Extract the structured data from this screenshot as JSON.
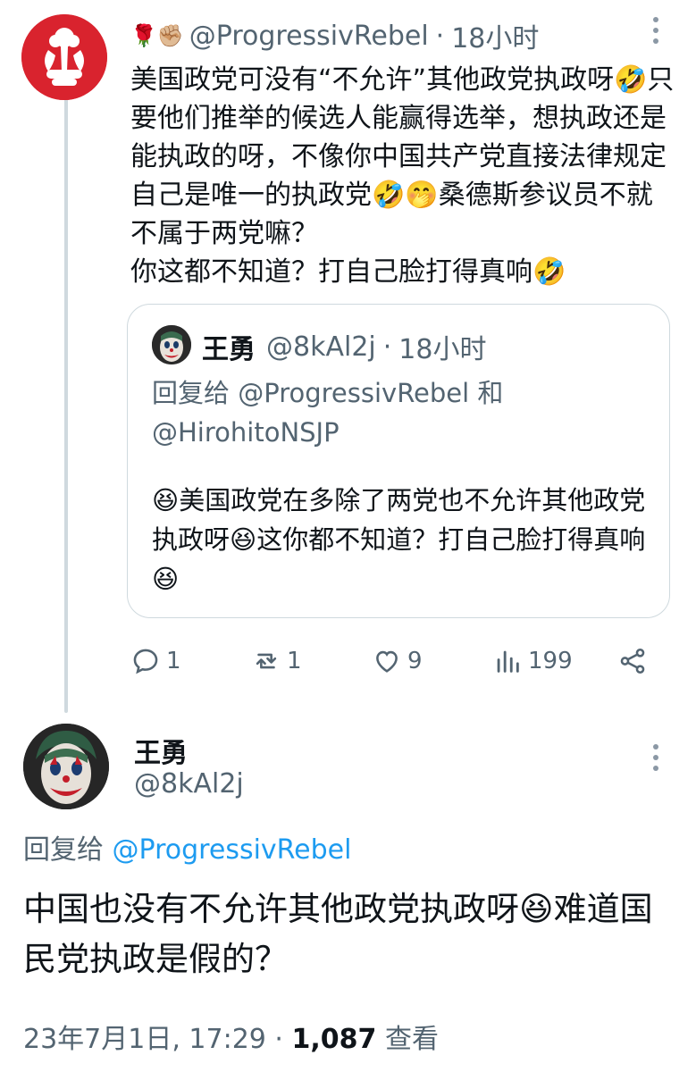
{
  "original_tweet": {
    "flair": "🌹✊🏼",
    "handle": "@ProgressivRebel",
    "separator": "·",
    "time": "18小时",
    "text": "美国政党可没有“不允许”其他政党执政呀🤣只要他们推举的候选人能赢得选举，想执政还是能执政的呀，不像你中国共产党直接法律规定自己是唯一的执政党🤣🤭桑德斯参议员不就不属于两党嘛？\n你这都不知道？打自己脸打得真响🤣",
    "quote": {
      "name": "王勇",
      "handle": "@8kAl2j",
      "separator": "·",
      "time": "18小时",
      "reply_prefix": "回复给 @ProgressivRebel 和 @HirohitoNSJP",
      "text": "😆美国政党在多除了两党也不允许其他政党执政呀😆这你都不知道？打自己脸打得真响😆"
    },
    "actions": {
      "reply_count": "1",
      "retweet_count": "1",
      "like_count": "9",
      "view_count": "199"
    }
  },
  "reply_tweet": {
    "name": "王勇",
    "handle": "@8kAl2j",
    "reply_label": "回复给",
    "reply_mention": "@ProgressivRebel",
    "text": "中国也没有不允许其他政党执政呀😆难道国民党执政是假的？",
    "timestamp": "23年7月1日, 17:29",
    "separator": "·",
    "views_count": "1,087",
    "views_label": "查看"
  },
  "colors": {
    "link": "#1d9bf0",
    "secondary": "#536471",
    "border": "#cfd9de",
    "avatar_red": "#d9232e"
  },
  "icons": [
    "more-icon",
    "reply-icon",
    "retweet-icon",
    "like-icon",
    "views-icon",
    "share-icon"
  ]
}
